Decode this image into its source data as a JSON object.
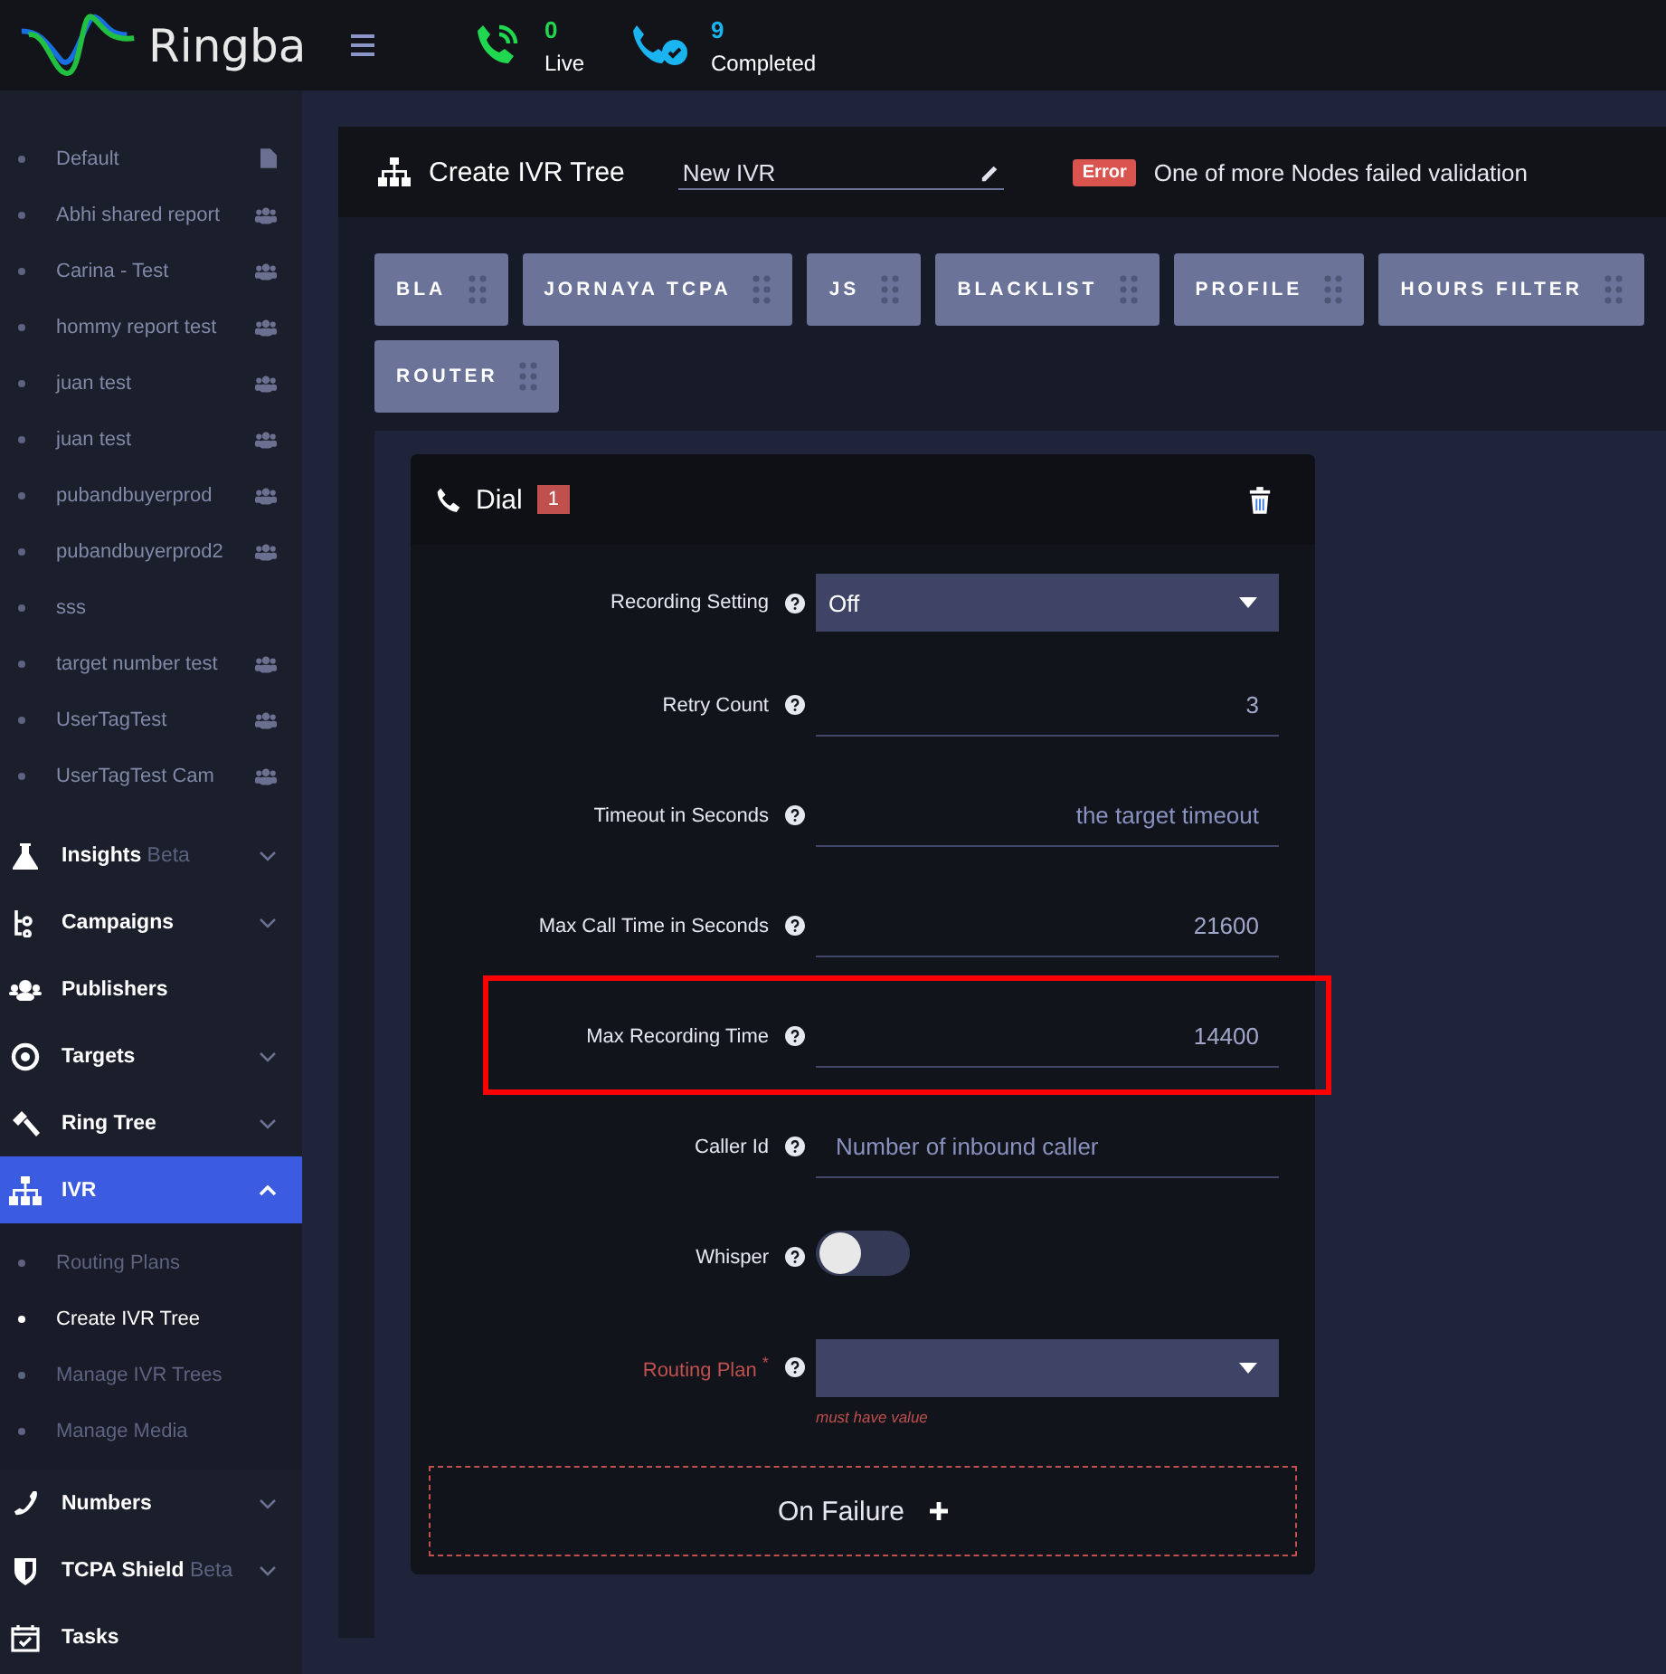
{
  "header": {
    "brand": "Ringba",
    "stats": [
      {
        "kind": "live",
        "value": "0",
        "label": "Live"
      },
      {
        "kind": "completed",
        "value": "9",
        "label": "Completed"
      }
    ]
  },
  "sidebar": {
    "reports": [
      {
        "label": "Default",
        "kind": "private"
      },
      {
        "label": "Abhi shared report",
        "kind": "shared"
      },
      {
        "label": "Carina - Test",
        "kind": "shared"
      },
      {
        "label": "hommy report test",
        "kind": "shared"
      },
      {
        "label": "juan test",
        "kind": "shared"
      },
      {
        "label": "juan test",
        "kind": "shared"
      },
      {
        "label": "pubandbuyerprod",
        "kind": "shared"
      },
      {
        "label": "pubandbuyerprod2",
        "kind": "shared"
      },
      {
        "label": "sss",
        "kind": "plain"
      },
      {
        "label": "target number test",
        "kind": "shared"
      },
      {
        "label": "UserTagTest",
        "kind": "shared"
      },
      {
        "label": "UserTagTest Cam",
        "kind": "shared"
      }
    ],
    "nav": [
      {
        "label": "Insights",
        "badge": "Beta",
        "expandable": true,
        "expanded": false,
        "selected": false
      },
      {
        "label": "Campaigns",
        "expandable": true,
        "expanded": false,
        "selected": false
      },
      {
        "label": "Publishers",
        "expandable": false,
        "selected": false
      },
      {
        "label": "Targets",
        "expandable": true,
        "expanded": false,
        "selected": false
      },
      {
        "label": "Ring Tree",
        "expandable": true,
        "expanded": false,
        "selected": false
      },
      {
        "label": "IVR",
        "expandable": true,
        "expanded": true,
        "selected": true,
        "children": [
          {
            "label": "Routing Plans",
            "selected": false
          },
          {
            "label": "Create IVR Tree",
            "selected": true
          },
          {
            "label": "Manage IVR Trees",
            "selected": false
          },
          {
            "label": "Manage Media",
            "selected": false
          }
        ]
      },
      {
        "label": "Numbers",
        "expandable": true,
        "expanded": false,
        "selected": false
      },
      {
        "label": "TCPA Shield",
        "badge": "Beta",
        "expandable": true,
        "expanded": false,
        "selected": false
      },
      {
        "label": "Tasks",
        "expandable": false,
        "selected": false
      }
    ]
  },
  "page": {
    "title": "Create IVR Tree",
    "name_field": {
      "value": "New IVR"
    },
    "error": {
      "badge": "Error",
      "message": "One of more Nodes failed validation"
    }
  },
  "nodes": [
    "BLA",
    "JORNAYA TCPA",
    "JS",
    "BLACKLIST",
    "PROFILE",
    "HOURS FILTER",
    "ROUTER"
  ],
  "dial_card": {
    "title": "Dial",
    "count": "1",
    "fields": [
      {
        "kind": "select",
        "label": "Recording Setting",
        "value": "Off",
        "required": false,
        "highlighted": false
      },
      {
        "kind": "input",
        "label": "Retry Count",
        "value": "3",
        "required": false,
        "highlighted": false
      },
      {
        "kind": "input",
        "label": "Timeout in Seconds",
        "placeholder": "the target timeout",
        "required": false,
        "highlighted": false
      },
      {
        "kind": "input",
        "label": "Max Call Time in Seconds",
        "value": "21600",
        "required": false,
        "highlighted": false
      },
      {
        "kind": "input",
        "label": "Max Recording Time",
        "value": "14400",
        "required": false,
        "highlighted": true
      },
      {
        "kind": "input-left",
        "label": "Caller Id",
        "placeholder": "Number of inbound caller",
        "required": false,
        "highlighted": false
      },
      {
        "kind": "toggle",
        "label": "Whisper",
        "on": false,
        "required": false,
        "highlighted": false
      },
      {
        "kind": "select",
        "label": "Routing Plan $^{*}$",
        "required": true,
        "error": "must have value",
        "highlighted": false
      }
    ],
    "on_failure": "On Failure"
  }
}
